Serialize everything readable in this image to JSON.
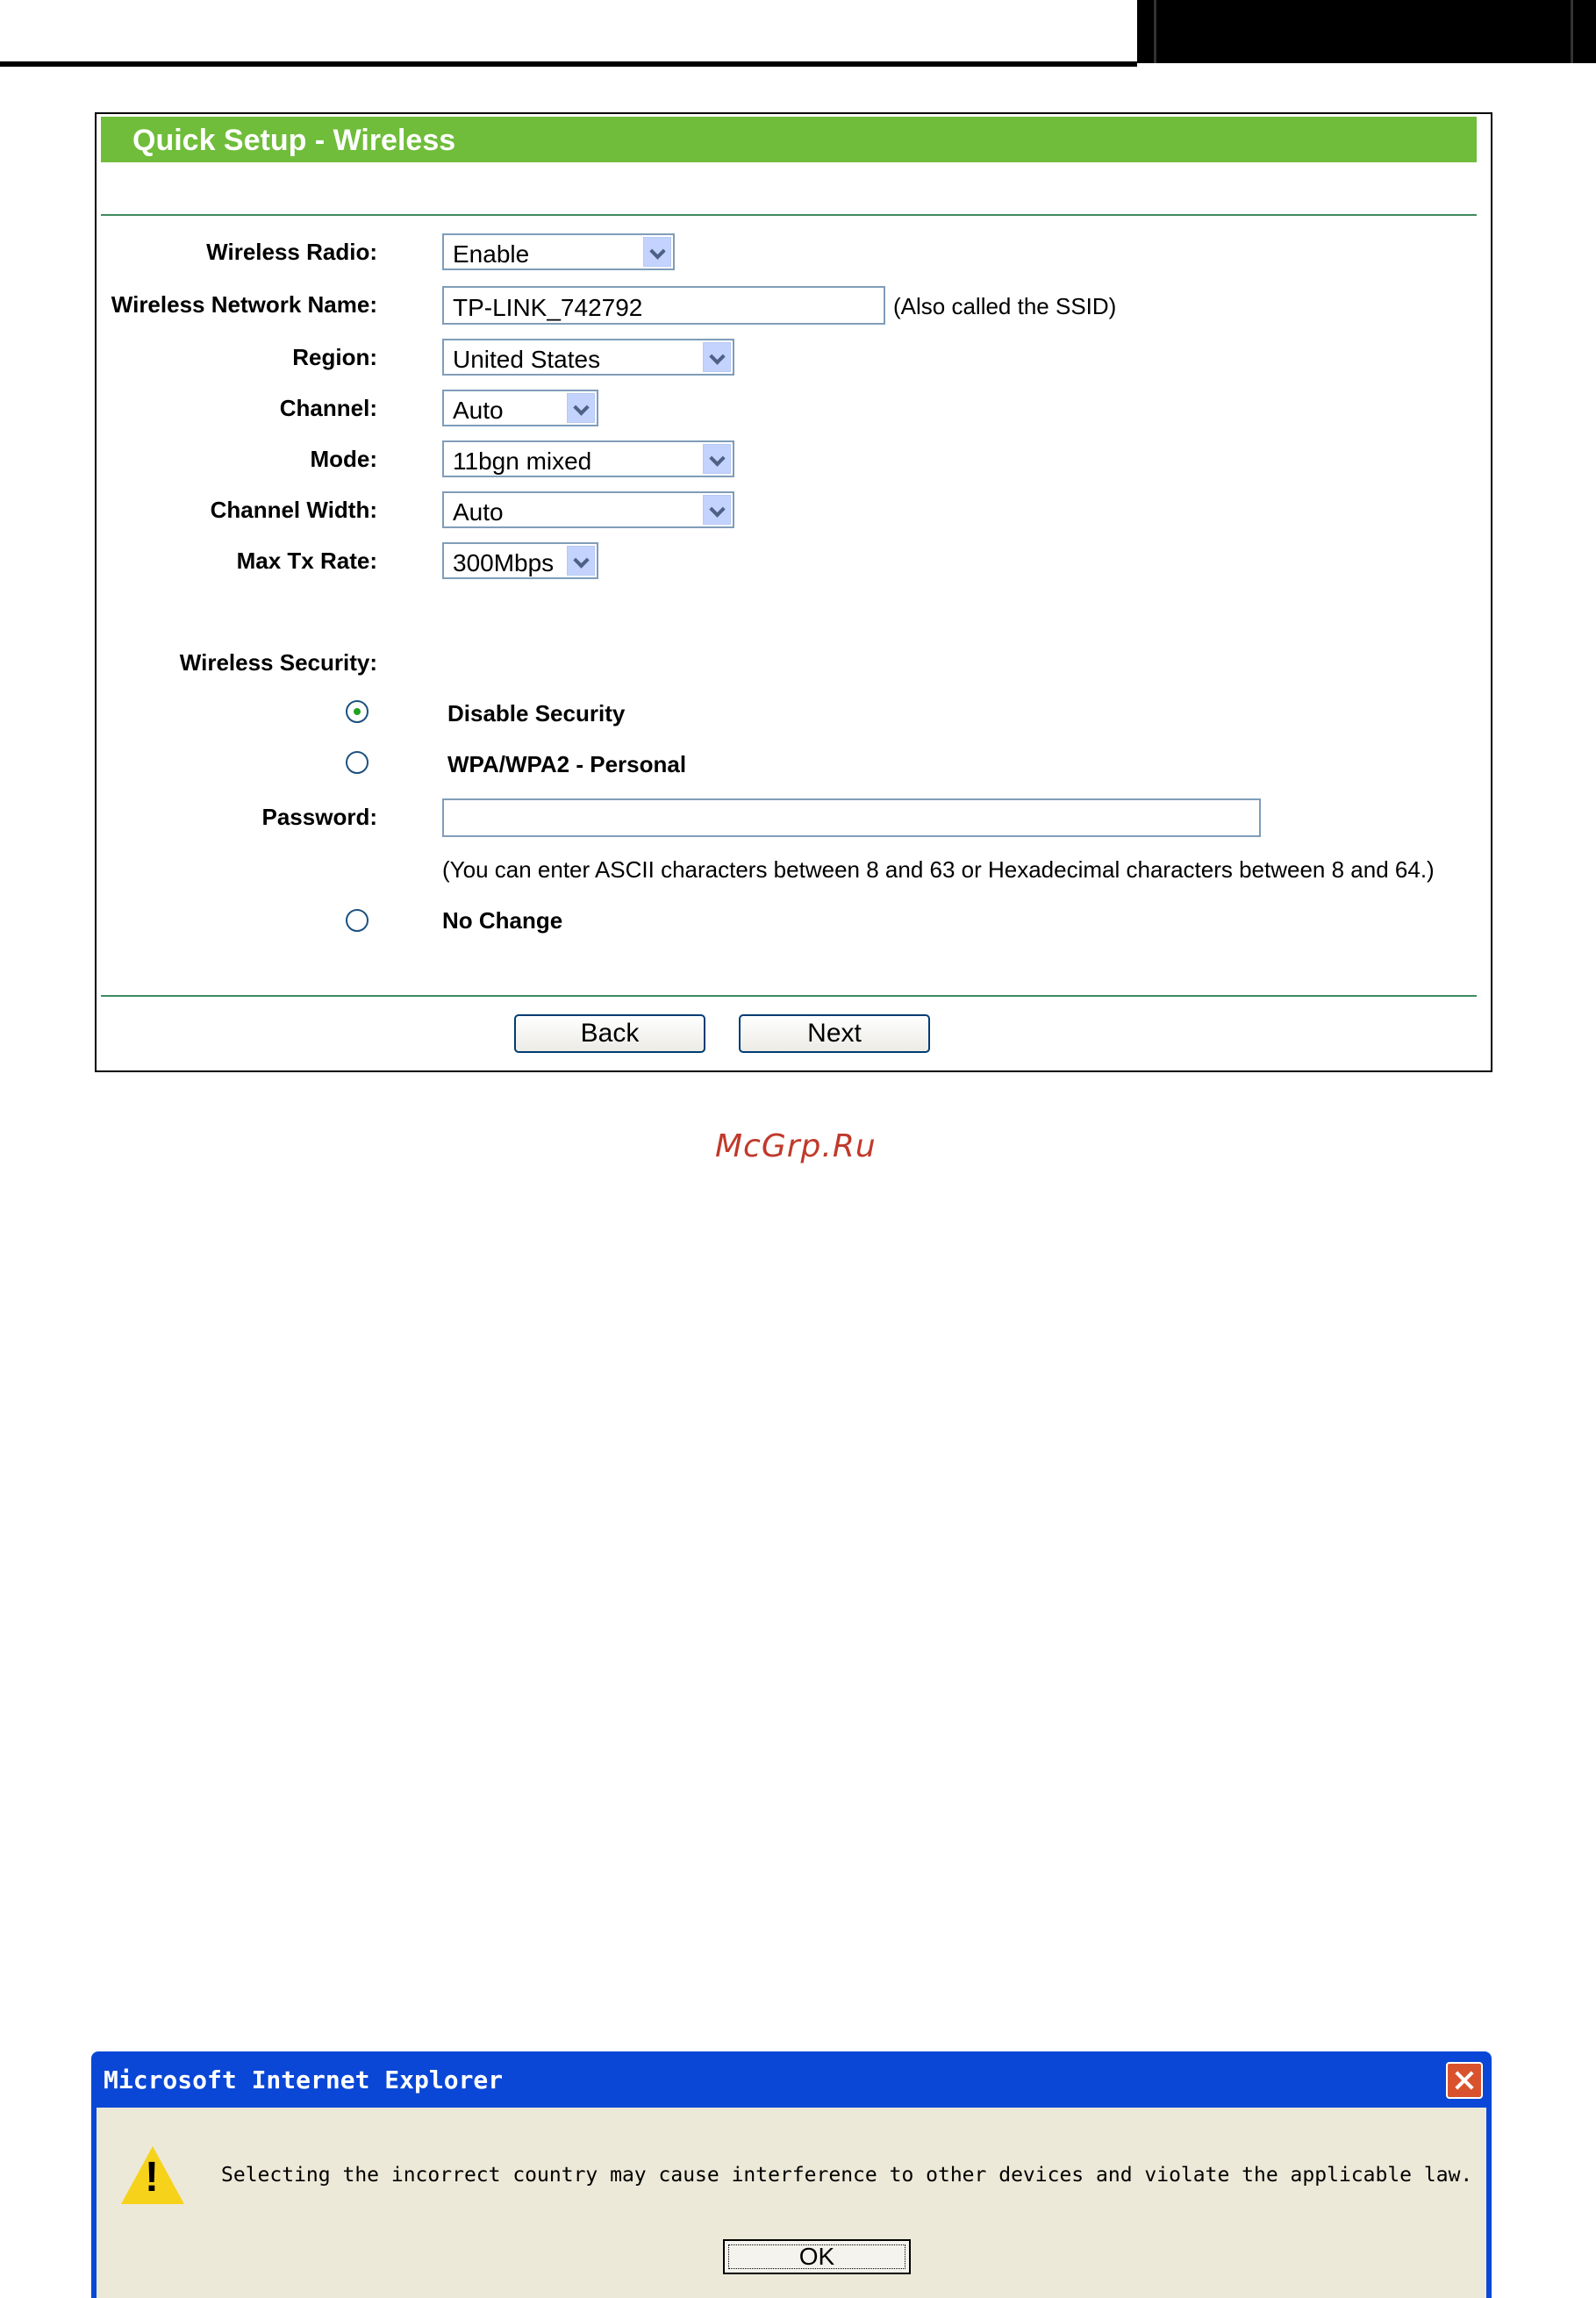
{
  "page": {
    "watermark": "McGrp.Ru"
  },
  "panel": {
    "title": "Quick Setup - Wireless",
    "wireless_radio": {
      "label": "Wireless Radio:",
      "value": "Enable"
    },
    "network_name": {
      "label": "Wireless Network Name:",
      "value": "TP-LINK_742792",
      "note": "(Also called the SSID)"
    },
    "region": {
      "label": "Region:",
      "value": "United States"
    },
    "channel": {
      "label": "Channel:",
      "value": "Auto"
    },
    "mode": {
      "label": "Mode:",
      "value": "11bgn mixed"
    },
    "channel_width": {
      "label": "Channel Width:",
      "value": "Auto"
    },
    "max_tx_rate": {
      "label": "Max Tx Rate:",
      "value": "300Mbps"
    },
    "security": {
      "label": "Wireless Security:",
      "options": [
        {
          "label": "Disable Security",
          "checked": true
        },
        {
          "label": "WPA/WPA2 - Personal",
          "checked": false
        },
        {
          "label": "No Change",
          "checked": false
        }
      ],
      "password_label": "Password:",
      "password_value": "",
      "password_note": "(You can enter ASCII characters between 8 and 63 or Hexadecimal characters between 8 and 64.)"
    },
    "buttons": {
      "back": "Back",
      "next": "Next"
    }
  },
  "dialog": {
    "title": "Microsoft Internet Explorer",
    "message": "Selecting the incorrect country may cause interference to other devices and violate the applicable law.",
    "ok": "OK",
    "icon": "warning-icon"
  },
  "colors": {
    "header_green": "#6fbd3a",
    "rule_green": "#3f8a5e",
    "dialog_blue": "#0a47d6"
  }
}
